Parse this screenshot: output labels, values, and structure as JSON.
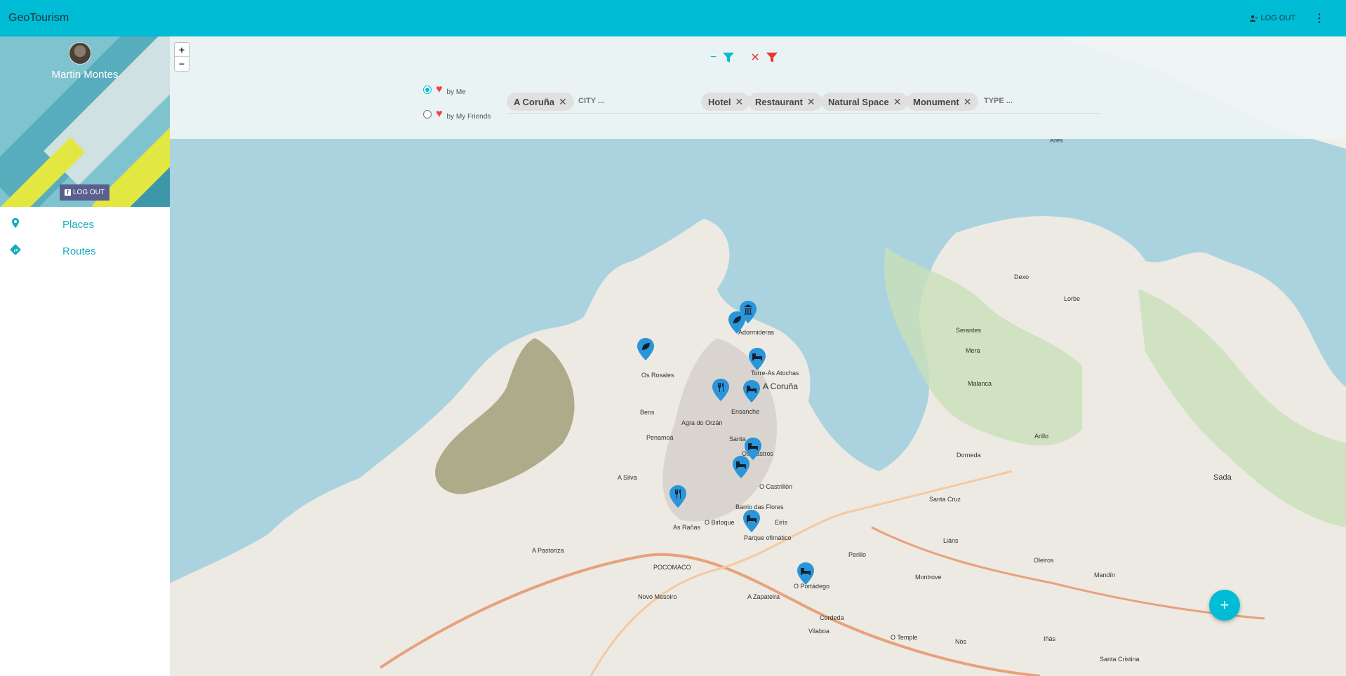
{
  "app": {
    "title": "GeoTourism"
  },
  "header": {
    "logout_label": "LOG OUT",
    "more_icon": "more-vert-icon"
  },
  "profile": {
    "name": "Martin Montes",
    "logout_label": "LOG OUT"
  },
  "sidebar": {
    "items": [
      {
        "label": "Places",
        "icon": "map-pin-icon"
      },
      {
        "label": "Routes",
        "icon": "directions-icon"
      }
    ]
  },
  "map": {
    "zoom_in": "+",
    "zoom_out": "−",
    "filters": {
      "collapse_label": "−",
      "clear_label": "✕",
      "radio_me": "by Me",
      "radio_friends": "by My Friends",
      "city_chip": "A Coruña",
      "city_placeholder": "CITY ...",
      "type_chips": [
        "Hotel",
        "Restaurant",
        "Natural Space",
        "Monument"
      ],
      "type_placeholder": "TYPE ..."
    },
    "place_labels": [
      "Dexo",
      "Lorbe",
      "Serantes",
      "Mera",
      "Ares",
      "Adormideras",
      "Torre-As Atochas",
      "A Coruña",
      "Os Rosales",
      "Ensanche",
      "Bens",
      "Agra do Orzán",
      "Penamoa",
      "Santa",
      "Os Castros",
      "O Castrillón",
      "Barrio das Flores",
      "Eirís",
      "Parque ofimático",
      "O Portádego",
      "A Silva",
      "Sada",
      "Oleiros",
      "Perillo",
      "Liáns",
      "O Birloque",
      "As Rañas",
      "A Pastoriza",
      "POCOMACO",
      "Novo Mesoiro",
      "A Zapateira",
      "Cordeda",
      "Vilaboa",
      "O Temple",
      "Nós",
      "Iñás",
      "Santa Cruz",
      "Dorneda",
      "Malanca",
      "Arillo",
      "Montrove",
      "Mandín",
      "Santa Cristina"
    ],
    "add_label": "+"
  }
}
